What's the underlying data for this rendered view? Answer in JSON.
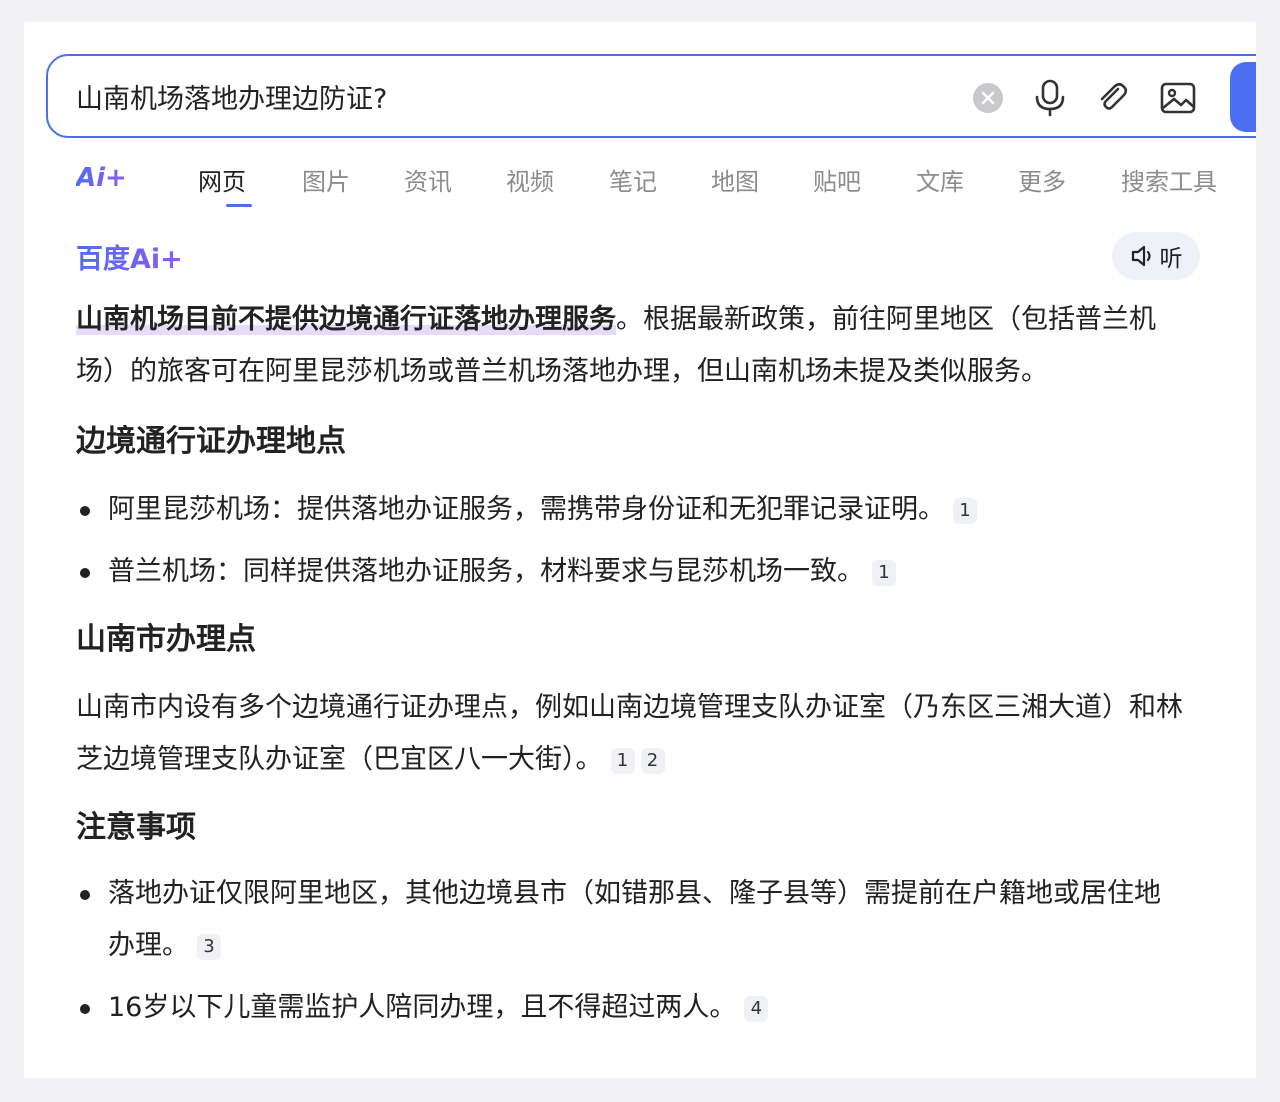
{
  "search": {
    "query": "山南机场落地办理边防证?",
    "clear_icon": "clear-icon",
    "mic_icon": "microphone-icon",
    "attach_icon": "paperclip-icon",
    "image_icon": "image-icon"
  },
  "tabs": {
    "ai_logo": "Ai+",
    "items": [
      "网页",
      "图片",
      "资讯",
      "视频",
      "笔记",
      "地图",
      "贴吧",
      "文库",
      "更多",
      "搜索工具"
    ],
    "active_index": 0
  },
  "answer": {
    "logo_text": "百度Ai+",
    "listen_label": "听",
    "summary_highlight": "山南机场目前不提供边境通行证落地办理服务",
    "summary_rest": "。根据最新政策，前往阿里地区（包括普兰机场）的旅客可在阿里昆莎机场或普兰机场落地办理，但山南机场未提及类似服务。",
    "sections": [
      {
        "heading": "边境通行证办理地点",
        "bullets": [
          {
            "text": "阿里昆莎机场：提供落地办证服务，需携带身份证和无犯罪记录证明。",
            "refs": [
              "1"
            ]
          },
          {
            "text": "普兰机场：同样提供落地办证服务，材料要求与昆莎机场一致。",
            "refs": [
              "1"
            ]
          }
        ]
      },
      {
        "heading": "山南市办理点",
        "paragraph": {
          "text": "山南市内设有多个边境通行证办理点，例如山南边境管理支队办证室（乃东区三湘大道）和林芝边境管理支队办证室（巴宜区八一大街）。",
          "refs": [
            "1",
            "2"
          ]
        }
      },
      {
        "heading": "注意事项",
        "bullets": [
          {
            "text": "落地办证仅限阿里地区，其他边境县市（如错那县、隆子县等）需提前在户籍地或居住地办理。",
            "refs": [
              "3"
            ]
          },
          {
            "text": "16岁以下儿童需监护人陪同办理，且不得超过两人。",
            "refs": [
              "4"
            ]
          }
        ]
      }
    ]
  },
  "colors": {
    "accent": "#4e6ef2",
    "highlight": "#e5dcfb",
    "ai_purple": "#8b5cf6"
  }
}
